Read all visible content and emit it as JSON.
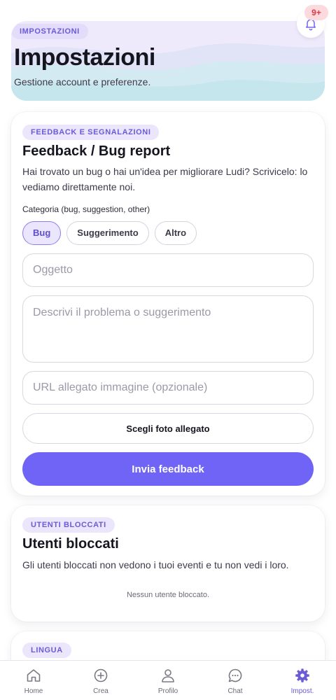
{
  "header": {
    "badge": "IMPOSTAZIONI",
    "title": "Impostazioni",
    "subtitle": "Gestione account e preferenze.",
    "notifications": {
      "icon": "bell-icon",
      "count": "9+"
    }
  },
  "feedback": {
    "badge": "FEEDBACK E SEGNALAZIONI",
    "title": "Feedback / Bug report",
    "description": "Hai trovato un bug o hai un'idea per migliorare Ludi? Scrivicelo: lo vediamo direttamente noi.",
    "category_label": "Categoria (bug, suggestion, other)",
    "categories": [
      {
        "label": "Bug",
        "selected": true
      },
      {
        "label": "Suggerimento",
        "selected": false
      },
      {
        "label": "Altro",
        "selected": false
      }
    ],
    "subject_placeholder": "Oggetto",
    "message_placeholder": "Descrivi il problema o suggerimento",
    "url_placeholder": "URL allegato immagine (opzionale)",
    "choose_photo_label": "Scegli foto allegato",
    "submit_label": "Invia feedback"
  },
  "blocked": {
    "badge": "UTENTI BLOCCATI",
    "title": "Utenti bloccati",
    "description": "Gli utenti bloccati non vedono i tuoi eventi e tu non vedi i loro.",
    "empty": "Nessun utente bloccato."
  },
  "language": {
    "badge": "LINGUA"
  },
  "tabbar": [
    {
      "label": "Home",
      "icon": "home-icon",
      "active": false
    },
    {
      "label": "Crea",
      "icon": "plus-circle-icon",
      "active": false
    },
    {
      "label": "Profilo",
      "icon": "user-icon",
      "active": false
    },
    {
      "label": "Chat",
      "icon": "chat-icon",
      "active": false
    },
    {
      "label": "Impost.",
      "icon": "gear-icon",
      "active": true
    }
  ],
  "colors": {
    "accent": "#7064f6",
    "badge_bg": "#ece6fd",
    "badge_text": "#6a5bd6",
    "notification": "#e2354a"
  }
}
